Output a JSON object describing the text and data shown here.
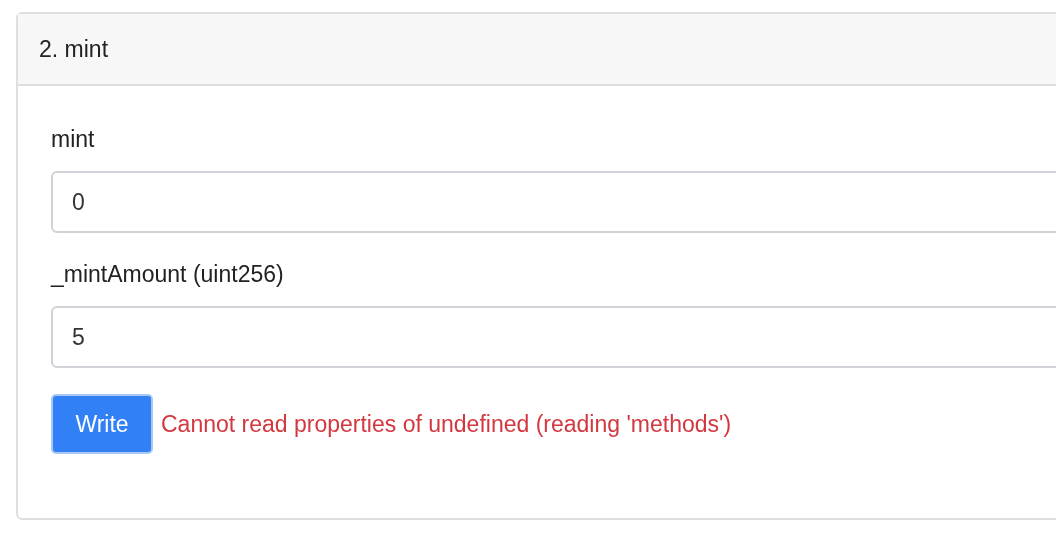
{
  "card": {
    "title": "2. mint"
  },
  "fields": [
    {
      "label": "mint",
      "value": "0"
    },
    {
      "label": "_mintAmount (uint256)",
      "value": "5"
    }
  ],
  "button": {
    "label": "Write"
  },
  "error": "Cannot read properties of undefined (reading 'methods')"
}
